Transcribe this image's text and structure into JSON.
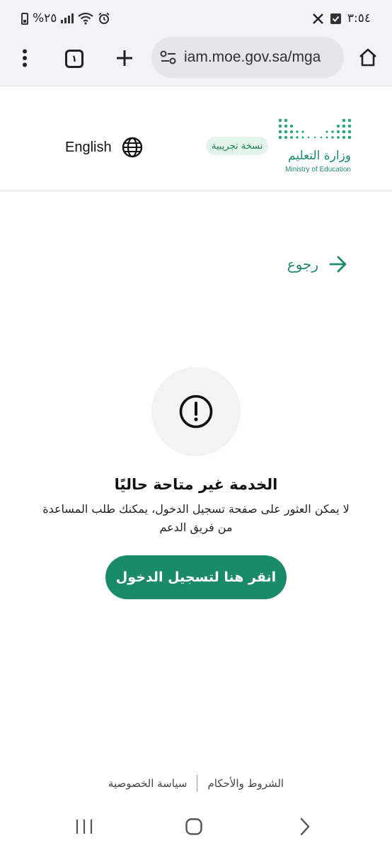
{
  "status_bar": {
    "time": "٣:٥٤",
    "battery_text": "%٢٥",
    "notification_icons": [
      "x-icon",
      "check-square-icon"
    ],
    "system_icons": [
      "battery-icon",
      "signal-icon",
      "wifi-icon",
      "alarm-icon"
    ]
  },
  "browser": {
    "tab_count": "١",
    "url": "iam.moe.gov.sa/mga"
  },
  "header": {
    "language_label": "English",
    "beta_badge": "نسخة تجريبية",
    "logo_ar": "وزارة التعليم",
    "logo_en": "Ministry of Education"
  },
  "back": {
    "label": "رجوع"
  },
  "error": {
    "title": "الخدمة غير متاحة حاليًا",
    "message": "لا يمكن العثور على صفحة تسجيل الدخول، يمكنك طلب المساعدة من فريق الدعم",
    "button_label": "انقر هنا لتسجيل الدخول"
  },
  "footer": {
    "terms": "الشروط والأحكام",
    "privacy": "سياسة الخصوصية"
  },
  "colors": {
    "brand_green": "#1b8a68",
    "badge_bg": "#e4f4ec",
    "chrome_bg": "#f3f3f7"
  }
}
